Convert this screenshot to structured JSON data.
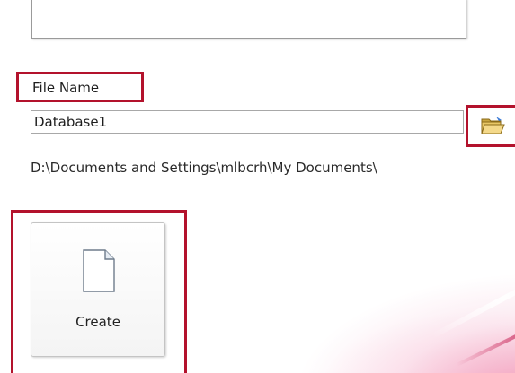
{
  "file_name": {
    "label": "File Name",
    "value": "Database1"
  },
  "save_path": "D:\\Documents and Settings\\mlbcrh\\My Documents\\",
  "browse": {
    "icon": "open-folder-icon"
  },
  "create_button": {
    "label": "Create",
    "icon": "blank-document-icon"
  },
  "highlight_color": "#b3122c"
}
